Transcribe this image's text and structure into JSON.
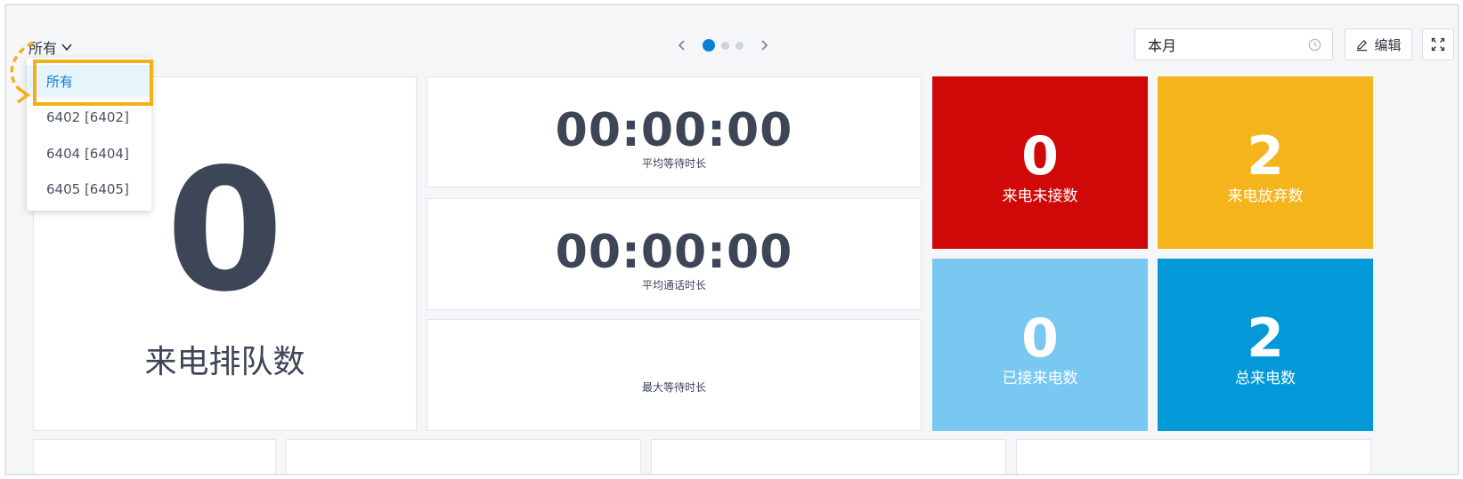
{
  "toolbar": {
    "scope_label": "所有",
    "range_value": "本月",
    "edit_label": "编辑"
  },
  "dropdown": {
    "items": [
      {
        "label": "所有",
        "selected": true
      },
      {
        "label": "6402 [6402]",
        "selected": false
      },
      {
        "label": "6404 [6404]",
        "selected": false
      },
      {
        "label": "6405 [6405]",
        "selected": false
      }
    ]
  },
  "carousel": {
    "pages": 3,
    "active": 1
  },
  "queue_card": {
    "value": "0",
    "label": "来电排队数"
  },
  "time_cards": [
    {
      "value": "00:00:00",
      "label": "平均等待时长"
    },
    {
      "value": "00:00:00",
      "label": "平均通话时长"
    },
    {
      "value": "",
      "label": "最大等待时长"
    }
  ],
  "tiles": [
    {
      "value": "0",
      "label": "来电未接数",
      "color": "#d10808"
    },
    {
      "value": "2",
      "label": "来电放弃数",
      "color": "#f5b41c"
    },
    {
      "value": "0",
      "label": "已接来电数",
      "color": "#78c8f2"
    },
    {
      "value": "2",
      "label": "总来电数",
      "color": "#0399d9"
    }
  ],
  "colors": {
    "accent": "#0a7fd6",
    "highlight": "#f4b018",
    "text": "#3c4656"
  },
  "icons": [
    "chevron-down-icon",
    "chevron-left-icon",
    "chevron-right-icon",
    "clock-icon",
    "pencil-icon",
    "fullscreen-icon"
  ]
}
